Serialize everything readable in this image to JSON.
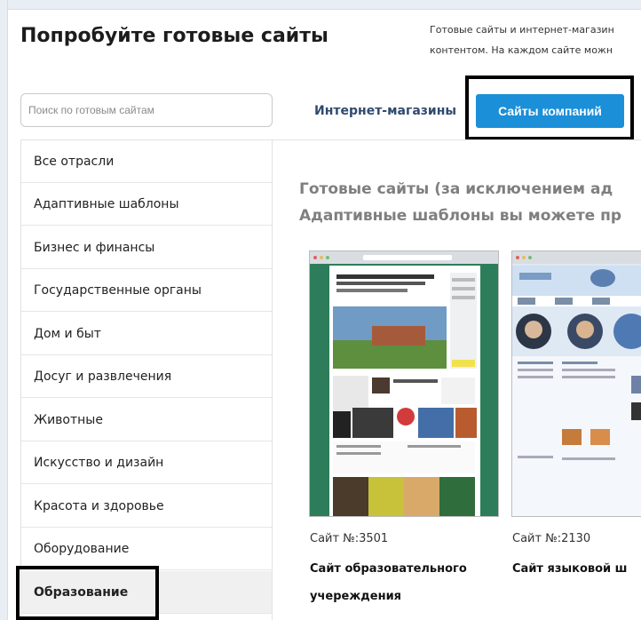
{
  "header": {
    "title": "Попробуйте готовые сайты",
    "intro_line1": "Готовые сайты и интернет-магазин",
    "intro_line2": "контентом. На каждом сайте можн"
  },
  "search": {
    "placeholder": "Поиск по готовым сайтам"
  },
  "tabs": {
    "shops": "Интернет-магазины",
    "companies": "Сайты компаний"
  },
  "sidebar": {
    "items": [
      {
        "label": "Все отрасли"
      },
      {
        "label": "Адаптивные шаблоны"
      },
      {
        "label": "Бизнес и финансы"
      },
      {
        "label": "Государственные органы"
      },
      {
        "label": "Дом и быт"
      },
      {
        "label": "Досуг и развлечения"
      },
      {
        "label": "Животные"
      },
      {
        "label": "Искусство и дизайн"
      },
      {
        "label": "Красота и здоровье"
      },
      {
        "label": "Оборудование"
      },
      {
        "label": "Образование"
      }
    ],
    "active_index": 10
  },
  "main": {
    "heading_line1": "Готовые сайты (за исключением ад",
    "heading_line2": "Адаптивные шаблоны вы можете пр",
    "cards": [
      {
        "number": "Сайт №:3501",
        "name_line1": "Сайт образовательного",
        "name_line2": "учереждения"
      },
      {
        "number": "Сайт №:2130",
        "name_line1": "Сайт языковой ш",
        "name_line2": ""
      }
    ]
  },
  "colors": {
    "accent_button": "#1b8fd8",
    "tab_link": "#2f4a6d",
    "highlight_border": "#000000"
  }
}
